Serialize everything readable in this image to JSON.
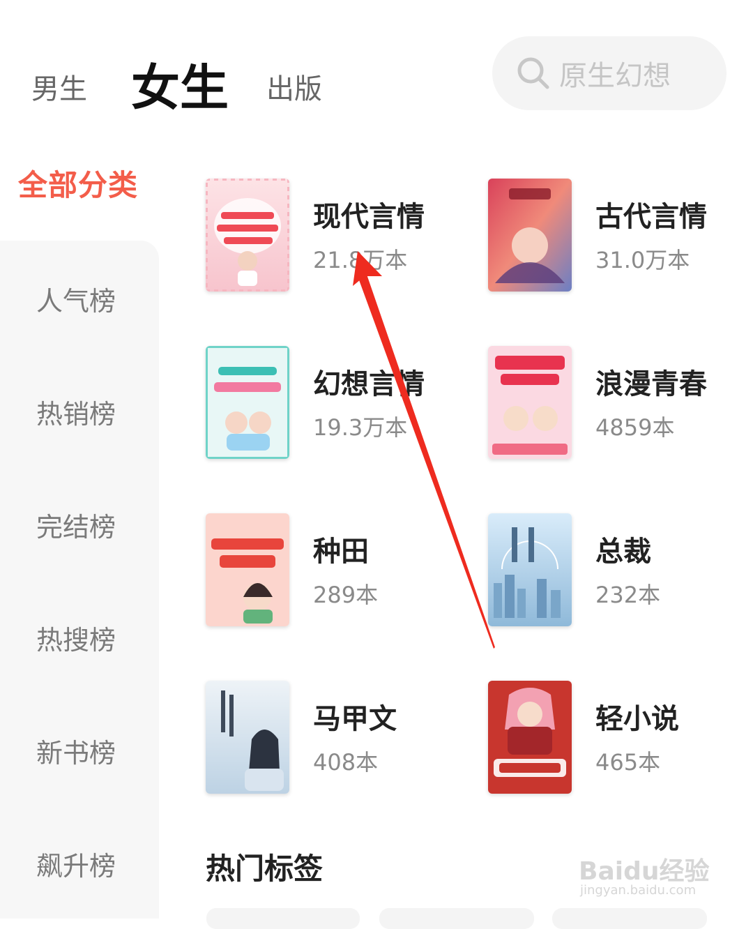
{
  "top_tabs": {
    "male": "男生",
    "female": "女生",
    "publish": "出版",
    "active": "female"
  },
  "search": {
    "placeholder": "原生幻想",
    "icon": "search-icon"
  },
  "sidebar": {
    "all_categories": "全部分类",
    "items": [
      {
        "label": "人气榜"
      },
      {
        "label": "热销榜"
      },
      {
        "label": "完结榜"
      },
      {
        "label": "热搜榜"
      },
      {
        "label": "新书榜"
      },
      {
        "label": "飙升榜"
      }
    ]
  },
  "categories": [
    {
      "name": "现代言情",
      "count": "21.8万本"
    },
    {
      "name": "古代言情",
      "count": "31.0万本"
    },
    {
      "name": "幻想言情",
      "count": "19.3万本"
    },
    {
      "name": "浪漫青春",
      "count": "4859本"
    },
    {
      "name": "种田",
      "count": "289本"
    },
    {
      "name": "总裁",
      "count": "232本"
    },
    {
      "name": "马甲文",
      "count": "408本"
    },
    {
      "name": "轻小说",
      "count": "465本"
    }
  ],
  "hot_tags": {
    "title": "热门标签"
  },
  "watermark": {
    "main": "Baidu经验",
    "sub": "jingyan.baidu.com"
  },
  "colors": {
    "accent": "#f35d4a",
    "arrow": "#ee2b1f"
  }
}
